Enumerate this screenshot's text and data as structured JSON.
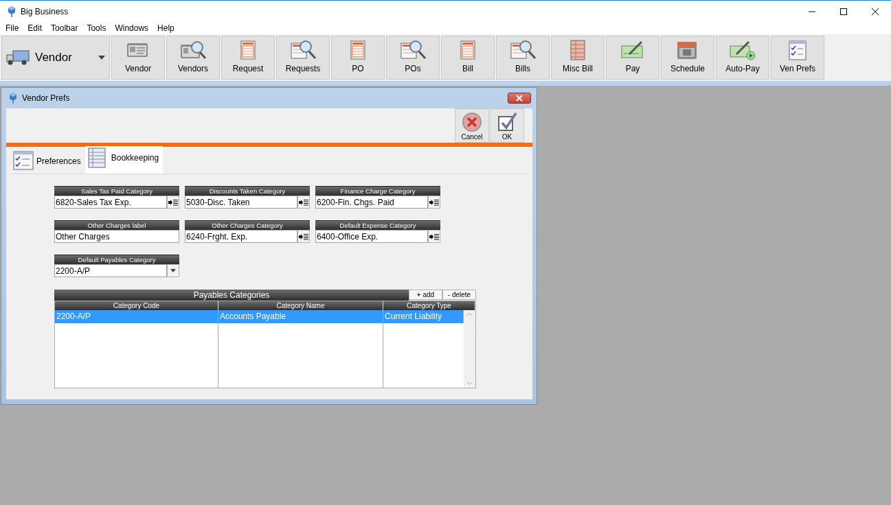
{
  "window": {
    "title": "Big Business"
  },
  "menu": [
    "File",
    "Edit",
    "Toolbar",
    "Tools",
    "Windows",
    "Help"
  ],
  "module_selector": {
    "label": "Vendor"
  },
  "toolbar": [
    "Vendor",
    "Vendors",
    "Request",
    "Requests",
    "PO",
    "POs",
    "Bill",
    "Bills",
    "Misc Bill",
    "Pay",
    "Schedule",
    "Auto-Pay",
    "Ven Prefs"
  ],
  "dialog": {
    "title": "Vendor Prefs",
    "buttons": [
      "Cancel",
      "OK"
    ],
    "tabs": [
      {
        "label": "Preferences",
        "selected": false
      },
      {
        "label": "Bookkeeping",
        "selected": true
      }
    ],
    "fields": [
      {
        "label": "Sales Tax Paid Category",
        "value": "6820-Sales Tax Exp.",
        "kind": "lookup"
      },
      {
        "label": "Discounts Taken Category",
        "value": "5030-Disc. Taken",
        "kind": "lookup"
      },
      {
        "label": "Finance Charge Category",
        "value": "6200-Fin. Chgs. Paid",
        "kind": "lookup"
      },
      {
        "label": "Other Charges label",
        "value": "Other Charges",
        "kind": "text"
      },
      {
        "label": "Other Charges Category",
        "value": "6240-Frght. Exp.",
        "kind": "lookup"
      },
      {
        "label": "Default Expense Category",
        "value": "6400-Office Exp.",
        "kind": "lookup"
      },
      {
        "label": "Default Payables Category",
        "value": "2200-A/P",
        "kind": "dropdown"
      }
    ],
    "table": {
      "title": "Payables Categories",
      "actions": [
        "+ add",
        "- delete"
      ],
      "columns": [
        "Category Code",
        "Category Name",
        "Category Type"
      ],
      "rows": [
        {
          "cells": [
            "2200-A/P",
            "Accounts Payable",
            "Current Liability"
          ],
          "selected": true
        }
      ]
    }
  }
}
